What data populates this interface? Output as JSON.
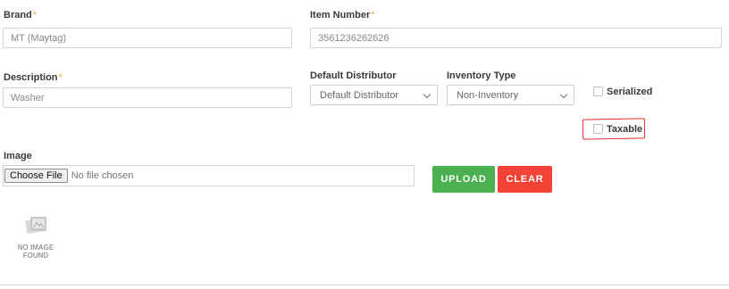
{
  "brand": {
    "label": "Brand",
    "required_mark": "*",
    "value": "MT (Maytag)"
  },
  "item_number": {
    "label": "Item Number",
    "required_mark": "*",
    "value": "3561236262626"
  },
  "description": {
    "label": "Description",
    "required_mark": "*",
    "placeholder": "Washer"
  },
  "default_distributor": {
    "label": "Default Distributor",
    "selected": "Default Distributor"
  },
  "inventory_type": {
    "label": "Inventory Type",
    "selected": "Non-Inventory"
  },
  "serialized": {
    "label": "Serialized",
    "checked": false
  },
  "taxable": {
    "label": "Taxable",
    "checked": false
  },
  "image": {
    "label": "Image",
    "choose_file_label": "Choose File",
    "file_status": "No file chosen",
    "upload_label": "UPLOAD",
    "clear_label": "CLEAR",
    "no_image_line1": "NO IMAGE",
    "no_image_line2": "FOUND"
  },
  "colors": {
    "required_mark": "#f0a33c",
    "upload_button": "#4caf50",
    "clear_button": "#f44336",
    "highlight": "#e32b2b"
  }
}
